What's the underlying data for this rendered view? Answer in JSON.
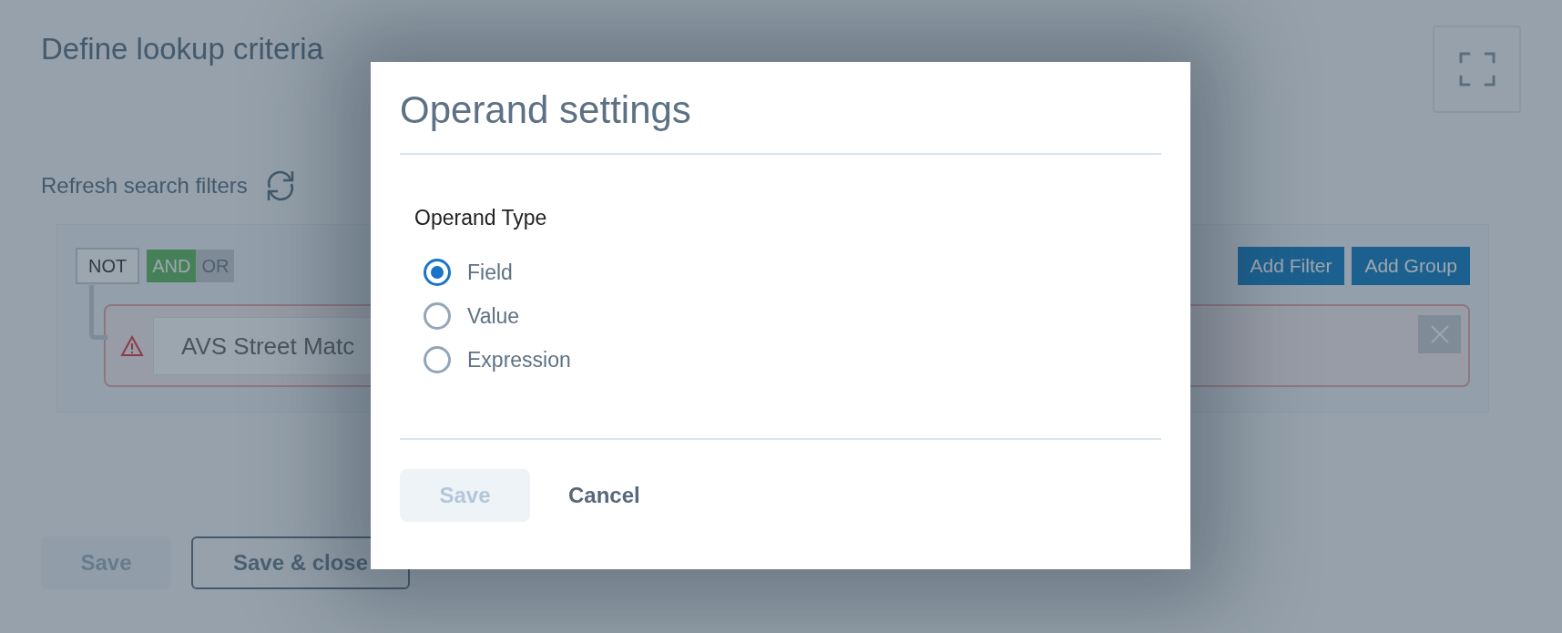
{
  "page": {
    "title": "Define lookup criteria",
    "refresh_label": "Refresh search filters",
    "filter_group": {
      "not_label": "NOT",
      "operators": [
        {
          "label": "AND",
          "selected": true
        },
        {
          "label": "OR",
          "selected": false
        }
      ],
      "buttons": [
        "Add Filter",
        "Add Group"
      ],
      "filters": [
        {
          "field": "AVS Street Matc",
          "invalid": true
        }
      ]
    },
    "buttons": [
      {
        "label": "Save",
        "kind": "primary",
        "disabled": true
      },
      {
        "label": "Save & close",
        "kind": "outline",
        "disabled": false
      }
    ]
  },
  "modal": {
    "title": "Operand settings",
    "group_label": "Operand Type",
    "options": [
      {
        "label": "Field",
        "selected": true
      },
      {
        "label": "Value",
        "selected": false
      },
      {
        "label": "Expression",
        "selected": false
      }
    ],
    "buttons": [
      {
        "label": "Save",
        "kind": "primary",
        "disabled": true
      },
      {
        "label": "Cancel",
        "kind": "link"
      }
    ]
  }
}
